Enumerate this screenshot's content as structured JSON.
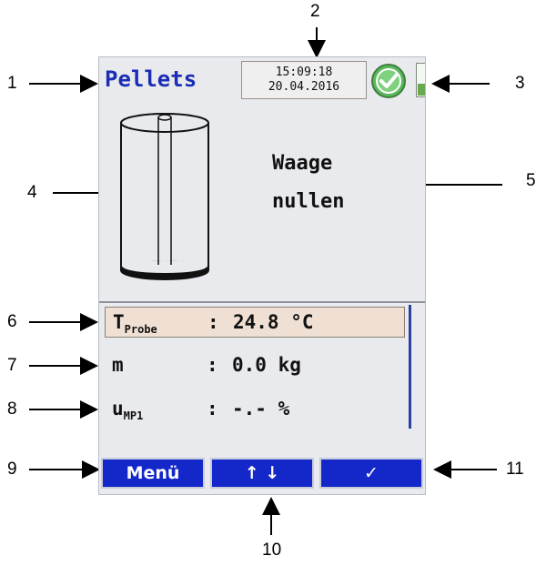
{
  "screen": {
    "title": "Pellets",
    "time": "15:09:18",
    "date": "20.04.2016",
    "status_icon": "check-circle-icon",
    "battery_level": 0.35,
    "message_line1": "Waage",
    "message_line2": "nullen"
  },
  "readings": [
    {
      "label_main": "T",
      "label_sub": "Probe",
      "colon": ":",
      "value": "24.8 °C"
    },
    {
      "label_main": "m",
      "label_sub": "",
      "colon": ":",
      "value": "0.0 kg"
    },
    {
      "label_main": "u",
      "label_sub": "MP1",
      "colon": ":",
      "value": "-.- %"
    }
  ],
  "buttons": {
    "menu": "Menü",
    "navigate": "↑ ↓",
    "confirm": "✓"
  },
  "callouts": [
    "1",
    "2",
    "3",
    "4",
    "5",
    "6",
    "7",
    "8",
    "9",
    "10",
    "11"
  ],
  "colors": {
    "title_blue": "#1a2db4",
    "button_blue": "#1427c8",
    "highlight_row": "#efe0d3",
    "status_green": "#5cb85c"
  }
}
